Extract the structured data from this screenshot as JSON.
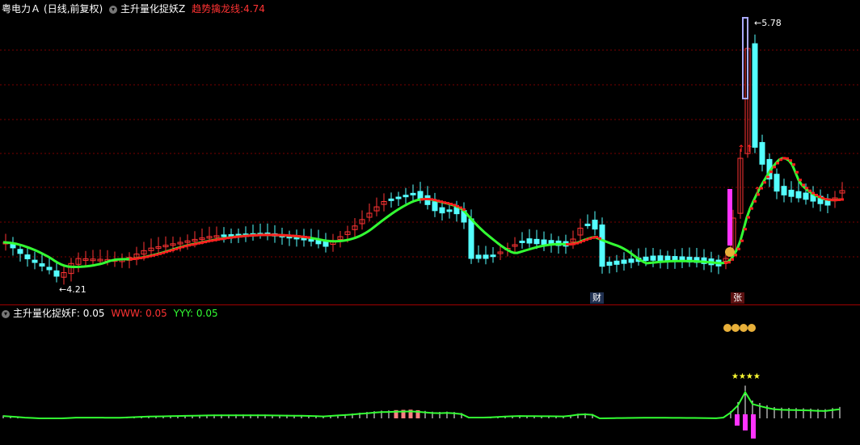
{
  "main": {
    "stock_name": "粤电力Ａ",
    "period_label": "(日线,前复权)",
    "indicator_name": "主升量化捉妖Z",
    "trend_label": "趋势擒龙线:",
    "trend_value": "4.74",
    "low_marker": "4.21",
    "high_marker": "5.78",
    "badge_cai": "财",
    "badge_zhang": "张"
  },
  "indicator": {
    "name": "主升量化捉妖F",
    "f_value": ": 0.05",
    "www_label": "WWW: 0.05",
    "yyy_label": "YYY: 0.05",
    "signal_text": "★★★★"
  },
  "colors": {
    "up": "#ff3333",
    "down": "#54ffff",
    "ma_green": "#33ff33",
    "ma_red": "#ff2020",
    "spike": "#ff33ff",
    "grid": "#7a0000"
  }
}
